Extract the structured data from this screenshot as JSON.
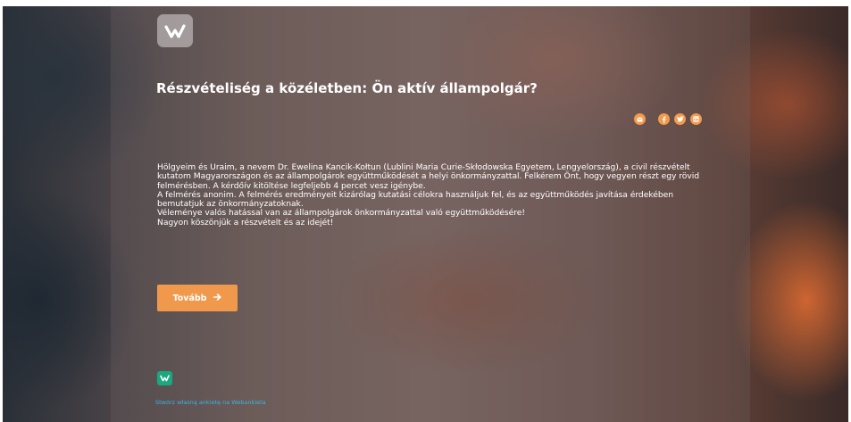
{
  "survey": {
    "title": "Részvételiség a közéletben: Ön aktív állampolgár?",
    "intro_lines": [
      "Hölgyeim és Uraim, a nevem Dr. Ewelina Kancik-Kołtun (Lublini Maria Curie-Skłodowska Egyetem, Lengyelország), a civil részvételt kutatom Magyarországon és az állampolgárok együttműködését a helyi önkormányzattal. Felkérem Önt, hogy vegyen részt egy rövid felmérésben. A kérdőív kitöltése legfeljebb 4 percet vesz igénybe.",
      "A felmérés anonim. A felmérés eredményeit kizárólag kutatási célokra használjuk fel, és az együttműködés javítása érdekében bemutatjuk az önkormányzatoknak.",
      "Véleménye valós hatással van az állampolgárok önkormányzattal való együttműködésére!",
      "Nagyon köszönjük a részvételt és az idejét!"
    ],
    "next_button_label": "Tovább"
  },
  "share_icons": [
    "email-icon",
    "facebook-icon",
    "twitter-icon",
    "linkedin-icon"
  ],
  "footer": {
    "link_text": "Stwórz własną ankietę na Webankieta"
  },
  "colors": {
    "accent": "#f0994d",
    "brand_green": "#1aa87e",
    "link": "#37b5e6"
  }
}
